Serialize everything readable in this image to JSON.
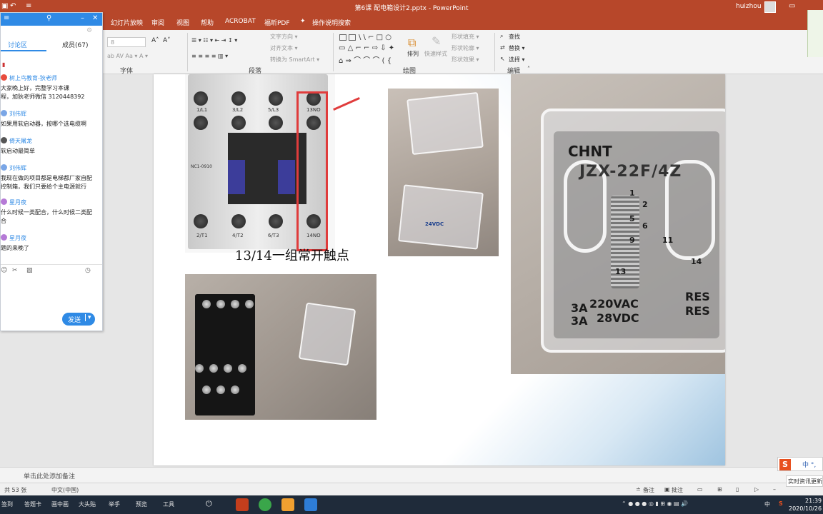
{
  "window": {
    "title": "第6课 配电箱设计2.pptx - PowerPoint",
    "user": "huizhou",
    "quick_access": [
      "日",
      "↶",
      "↷",
      "=",
      "ᵥ"
    ]
  },
  "tabs": [
    "幻灯片放映",
    "审阅",
    "视图",
    "帮助",
    "ACROBAT",
    "福昕PDF",
    "操作说明搜索"
  ],
  "ribbon": {
    "groups": [
      "字体",
      "段落",
      "绘图",
      "编辑"
    ],
    "paragraph_items": [
      "文字方向 ▾",
      "对齐文本 ▾",
      "转换为 SmartArt ▾"
    ],
    "drawing_items": [
      "排列",
      "快速样式",
      "形状填充 ▾",
      "形状轮廓 ▾",
      "形状效果 ▾"
    ],
    "editing_items": [
      "查找",
      "替换 ▾",
      "选择 ▾"
    ],
    "font_size": "8"
  },
  "panel": {
    "tab_active": "讨论区",
    "tab_members": "成员(67)",
    "messages": [
      {
        "name": "",
        "text": "▮"
      },
      {
        "name": "树上鸟教育-狄老师",
        "lines": [
          "大家晚上好，完整学习本课",
          "程，加狄老师微信 3120448392"
        ]
      },
      {
        "name": "刘伟辉",
        "lines": [
          "如果用软启动器，按哪个选电缆啊"
        ]
      },
      {
        "name": "倚天屠龙",
        "lines": [
          "软启动最简单"
        ]
      },
      {
        "name": "刘伟辉",
        "lines": [
          "我现在做的项目都是电梯都厂家自配",
          "控制箱，我们只要给个主电源就行"
        ]
      },
      {
        "name": "星月夜",
        "lines": [
          "什么时候一类配合，什么时候二类配",
          "合"
        ]
      },
      {
        "name": "星月夜",
        "lines": [
          "题的来晚了"
        ]
      }
    ],
    "send_label": "发送"
  },
  "slide": {
    "caption": "13/14一组常开触点",
    "contactor": {
      "top_terminals": [
        "1/L1",
        "3/L2",
        "5/L3",
        "13NO"
      ],
      "bottom_terminals": [
        "2/T1",
        "4/T2",
        "6/T3",
        "14NO"
      ],
      "model": "NC1-0910"
    },
    "relay_photo_labels": [
      "24VDC"
    ],
    "big_relay": {
      "brand": "CHNT",
      "model": "JZX-22F/4Z",
      "rating_ac": "220VAC",
      "rating_dc": "28VDC",
      "amp_left": "3A",
      "amp_left2": "3A",
      "res1": "RES",
      "res2": "RES",
      "pins": [
        "1",
        "2",
        "5",
        "6",
        "9",
        "11",
        "13",
        "14"
      ]
    }
  },
  "notes_placeholder": "单击此处添加备注",
  "status": {
    "slide_count": "共 53 张",
    "language": "中文(中国)",
    "notes_btn": "备注",
    "comments_btn": "批注"
  },
  "taskbar": {
    "items": [
      "签到",
      "答题卡",
      "画中画",
      "大头贴",
      "举手",
      "预览",
      "工具"
    ],
    "time": "21:39",
    "date": "2020/10/26",
    "ime_lang": "中"
  },
  "ime": {
    "logo": "S",
    "mode": "中 °,"
  },
  "news": "实时资讯更新"
}
